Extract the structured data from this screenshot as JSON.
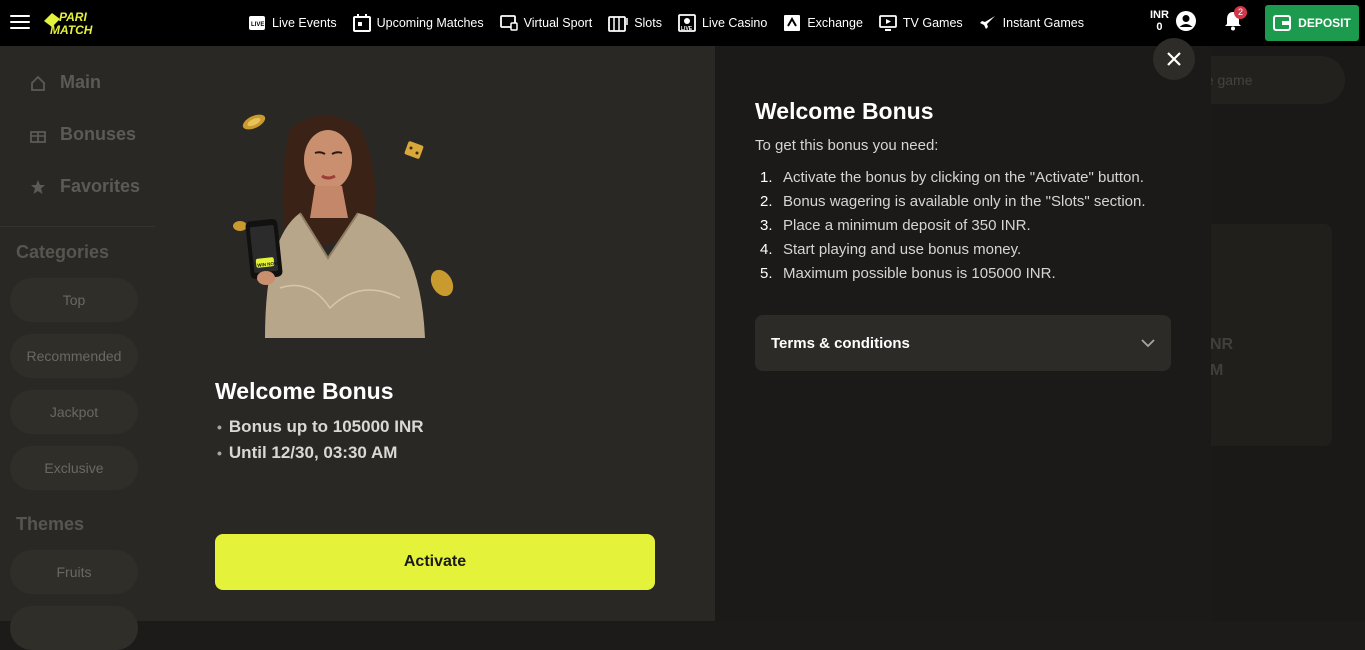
{
  "header": {
    "brand": "PARIMATCH",
    "nav": [
      {
        "label": "Live Events",
        "icon": "live-icon"
      },
      {
        "label": "Upcoming Matches",
        "icon": "calendar-icon"
      },
      {
        "label": "Virtual Sport",
        "icon": "monitor-icon"
      },
      {
        "label": "Slots",
        "icon": "slots-icon"
      },
      {
        "label": "Live Casino",
        "icon": "live-casino-icon"
      },
      {
        "label": "Exchange",
        "icon": "exchange-icon"
      },
      {
        "label": "TV Games",
        "icon": "tv-icon"
      },
      {
        "label": "Instant Games",
        "icon": "rocket-icon"
      }
    ],
    "currency": "INR",
    "balance": "0",
    "notifications_count": "2",
    "deposit_label": "DEPOSIT"
  },
  "sidebar": {
    "links": [
      {
        "label": "Main",
        "icon": "home-icon"
      },
      {
        "label": "Bonuses",
        "icon": "gift-icon"
      },
      {
        "label": "Favorites",
        "icon": "star-icon"
      }
    ],
    "categories_heading": "Categories",
    "categories": [
      "Top",
      "Recommended",
      "Jackpot",
      "Exclusive"
    ],
    "themes_heading": "Themes",
    "themes": [
      "Fruits"
    ]
  },
  "background": {
    "search_placeholder": "he game",
    "card_text_1": "NR",
    "card_text_2": "M"
  },
  "modal": {
    "left": {
      "title": "Welcome Bonus",
      "bullets": [
        "Bonus up to 105000 INR",
        "Until 12/30, 03:30 AM"
      ],
      "activate_label": "Activate"
    },
    "right": {
      "title": "Welcome Bonus",
      "subtitle": "To get this bonus you need:",
      "steps": [
        "Activate the bonus by clicking on the \"Activate\" button.",
        "Bonus wagering is available only in the \"Slots\" section.",
        "Place a minimum deposit of 350 INR.",
        "Start playing and use bonus money.",
        "Maximum possible bonus is 105000 INR."
      ],
      "step_numbers": [
        "1.",
        "2.",
        "3.",
        "4.",
        "5."
      ],
      "terms_label": "Terms & conditions"
    },
    "hero_phone_text": "WIN NOW"
  },
  "colors": {
    "accent_yellow": "#e4f23a",
    "deposit_green": "#1c9b4e",
    "badge_red": "#d3364a"
  }
}
